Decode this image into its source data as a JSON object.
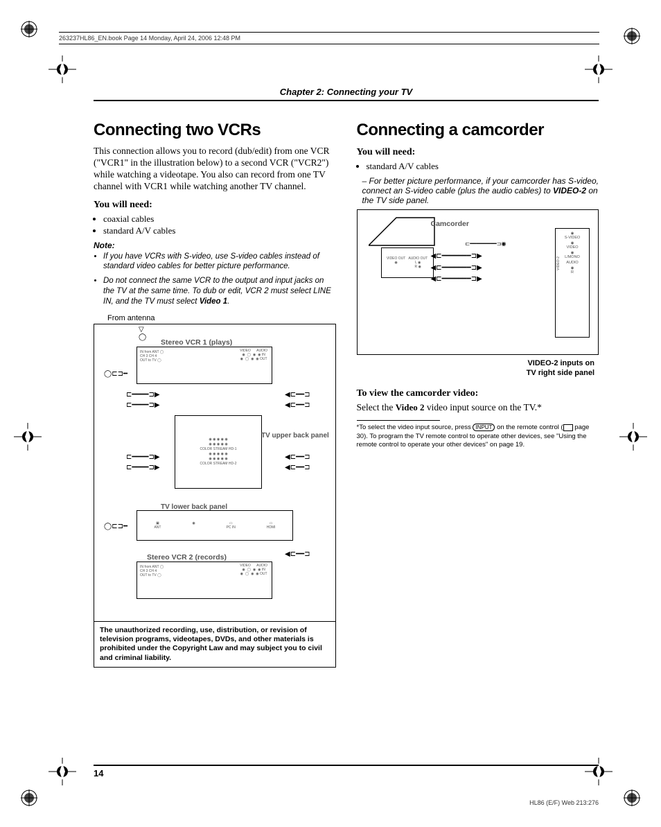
{
  "header_line": "263237HL86_EN.book  Page 14  Monday, April 24, 2006  12:48 PM",
  "chapter": "Chapter 2: Connecting your TV",
  "left": {
    "title": "Connecting two VCRs",
    "intro": "This connection allows you to record (dub/edit) from one VCR (\"VCR1\" in the illustration below) to a second VCR (\"VCR2\") while watching a videotape. You also can record from one TV channel with VCR1 while watching another TV channel.",
    "need_heading": "You will need:",
    "need_items": [
      "coaxial cables",
      "standard A/V cables"
    ],
    "note_label": "Note:",
    "notes": [
      "If you have VCRs with S-video, use S-video cables instead of standard video cables for better picture performance.",
      "Do not connect the same VCR to the output and input jacks on the TV at the same time. To dub or edit, VCR 2 must select LINE IN, and the TV must select "
    ],
    "notes_video1": "Video 1",
    "diagram": {
      "from_antenna": "From antenna",
      "vcr1": "Stereo VCR 1 (plays)",
      "upper_panel": "TV upper back panel",
      "lower_panel": "TV lower back panel",
      "vcr2": "Stereo VCR 2 (records)",
      "video": "VIDEO",
      "audio": "AUDIO",
      "in_ant": "IN from ANT",
      "out_tv": "OUT to TV",
      "ch34": "CH 3\nCH 4",
      "in": "IN",
      "out": "OUT",
      "hdmi": "HDMI",
      "colorstream1": "COLOR\nSTREAM\nHD-1",
      "colorstream2": "COLOR\nSTREAM\nHD-2",
      "ant": "ANT",
      "pcin": "PC IN"
    },
    "warning": "The unauthorized recording, use, distribution, or revision of television programs, videotapes, DVDs, and other materials is prohibited under the Copyright Law and may subject you to civil and criminal liability."
  },
  "right": {
    "title": "Connecting a camcorder",
    "need_heading": "You will need:",
    "need_items": [
      "standard A/V cables"
    ],
    "need_sub_prefix": "For better picture performance, if your camcorder has S-video, connect an S-video cable (plus the audio cables) to ",
    "need_sub_bold": "VIDEO-2",
    "need_sub_suffix": " on the TV side panel.",
    "diagram": {
      "camcorder": "Camcorder",
      "video_out": "VIDEO\nOUT",
      "audio_out": "AUDIO\nOUT",
      "l": "L",
      "r": "R",
      "svideo": "S-VIDEO",
      "video": "VIDEO",
      "lmono": "L/MONO",
      "audio": "AUDIO",
      "r2": "R",
      "panel": "VIDEO-2"
    },
    "caption": "VIDEO-2 inputs on\nTV right side panel",
    "view_heading": "To view the camcorder video:",
    "view_body_pre": "Select the ",
    "view_body_bold": "Video 2",
    "view_body_post": " video input source on the TV.*",
    "footnote_pre": "*To select the video input source, press ",
    "footnote_key": "INPUT",
    "footnote_mid1": " on the remote control (",
    "footnote_mid2": " page 30). To program the TV remote control to operate other devices, see \"Using the remote control to operate your other devices\" on page 19."
  },
  "page_number": "14",
  "footer_right": "HL86 (E/F) Web 213:276"
}
